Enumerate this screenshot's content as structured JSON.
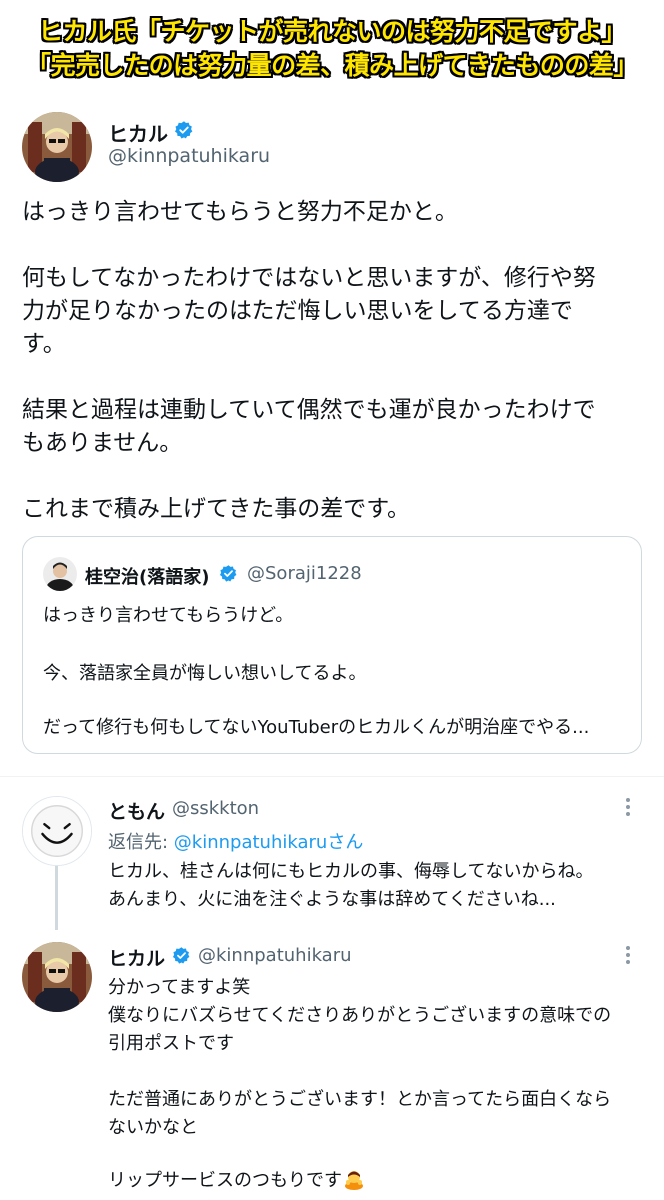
{
  "headline": {
    "line1": "ヒカル氏「チケットが売れないのは努力不足ですよ」",
    "line2": "「完売したのは努力量の差、積み上げてきたものの差」"
  },
  "main_tweet": {
    "author_name": "ヒカル",
    "author_handle": "@kinnpatuhikaru",
    "verified_icon": "verified-badge-icon",
    "lines": [
      "はっきり言わせてもらうと努力不足かと。",
      "",
      "何もしてなかったわけではないと思いますが、修行や努",
      "力が足りなかったのはただ悔しい思いをしてる方達で",
      "す。",
      "",
      "結果と過程は連動していて偶然でも運が良かったわけで",
      "もありません。",
      "",
      "これまで積み上げてきた事の差です。"
    ]
  },
  "quoted_tweet": {
    "author_name": "桂空治(落語家)",
    "author_handle": "@Soraji1228",
    "lines": [
      "はっきり言わせてもらうけど。",
      "今、落語家全員が悔しい想いしてるよ。",
      "だって修行も何もしてないYouTuberのヒカルくんが明治座でやる..."
    ]
  },
  "reply_1": {
    "author_name": "ともん",
    "author_handle": "@sskkton",
    "reply_to_prefix": "返信先: ",
    "reply_to_mention": "@kinnpatuhikaruさん",
    "lines": [
      "ヒカル、桂さんは何にもヒカルの事、侮辱してないからね。",
      "あんまり、火に油を注ぐような事は辞めてくださいね..."
    ],
    "more_icon": "more-options-icon"
  },
  "reply_2": {
    "author_name": "ヒカル",
    "author_handle": "@kinnpatuhikaru",
    "lines": [
      "分かってますよ笑",
      "僕なりにバズらせてくださりありがとうございますの意味での",
      "引用ポストです",
      "",
      "ただ普通にありがとうございます！とか言ってたら面白くなら",
      "ないかなと",
      "",
      "リップサービスのつもりです"
    ],
    "emoji_icon": "person-bowing-emoji-icon",
    "more_icon": "more-options-icon"
  },
  "colors": {
    "headline_fill": "#ffe600",
    "headline_outline": "#000000",
    "verified_blue": "#1d9bf0",
    "text_primary": "#0f1419",
    "text_secondary": "#536471",
    "link_blue": "#1d9bf0",
    "border": "#cfd9de"
  }
}
